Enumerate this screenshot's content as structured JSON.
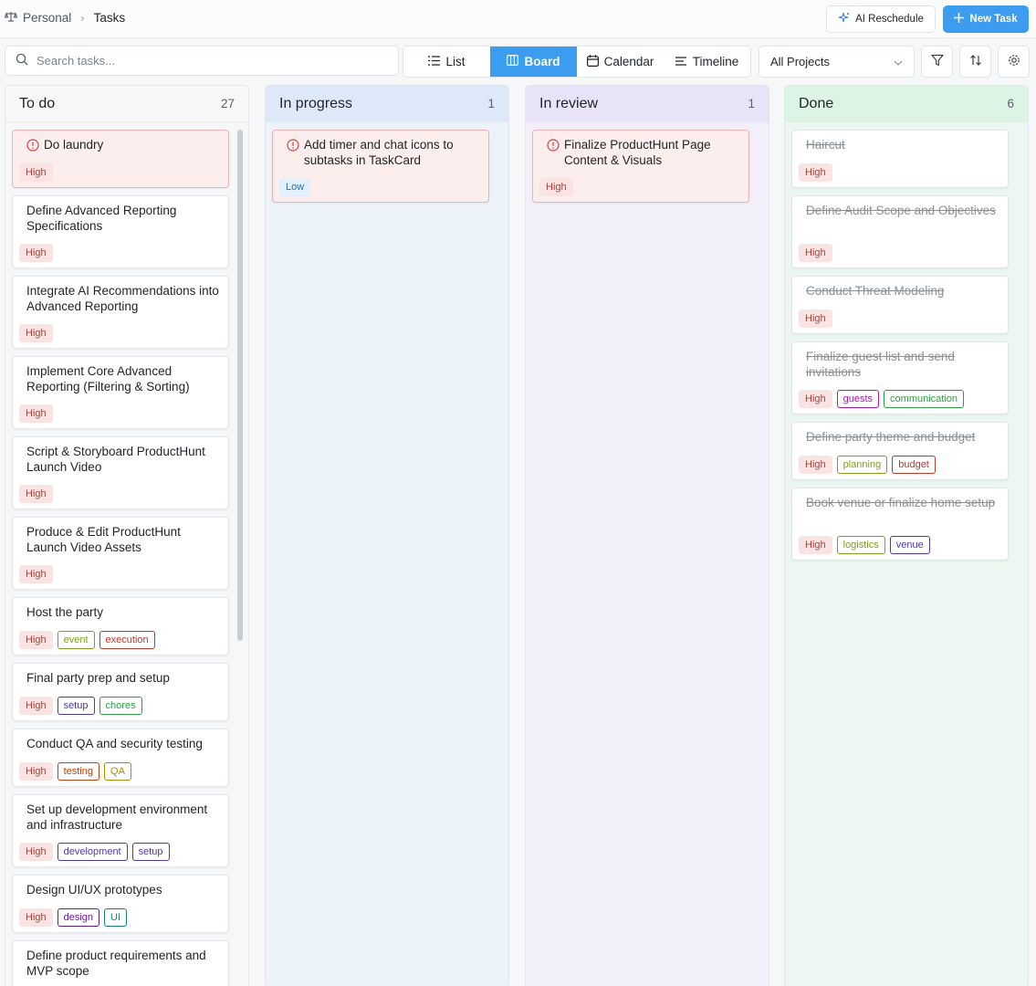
{
  "breadcrumb": {
    "parent": "Personal",
    "current": "Tasks"
  },
  "header": {
    "ai_label": "AI Reschedule",
    "new_label": "New Task"
  },
  "search": {
    "placeholder": "Search tasks..."
  },
  "views": [
    {
      "label": "List",
      "icon": "list-icon",
      "active": false
    },
    {
      "label": "Board",
      "icon": "board-icon",
      "active": true
    },
    {
      "label": "Calendar",
      "icon": "calendar-icon",
      "active": false
    },
    {
      "label": "Timeline",
      "icon": "timeline-icon",
      "active": false
    }
  ],
  "project_filter": {
    "value": "All Projects"
  },
  "tag_colors": {
    "event": "#7fa11e",
    "execution": "#c0392b",
    "setup": "#4b3ca7",
    "chores": "#2f9e44",
    "testing": "#c2410c",
    "QA": "#b58a00",
    "development": "#4b3ca7",
    "design": "#6a1b9a",
    "UI": "#14847a",
    "guests": "#a21caf",
    "communication": "#2f9e44",
    "planning": "#7fa11e",
    "budget": "#c0392b",
    "logistics": "#7fa11e",
    "venue": "#4b3ca7"
  },
  "columns": [
    {
      "title": "To do",
      "count": "27",
      "bg": "#f6f7f9",
      "head_bg": "#f6f7f9",
      "cards": [
        {
          "title": "Do laundry",
          "priority": "High",
          "tags": [],
          "urgent": true,
          "done": false
        },
        {
          "title": "Define Advanced Reporting Specifications",
          "priority": "High",
          "tags": [],
          "urgent": false,
          "done": false
        },
        {
          "title": "Integrate AI Recommendations into Advanced Reporting",
          "priority": "High",
          "tags": [],
          "urgent": false,
          "done": false
        },
        {
          "title": "Implement Core Advanced Reporting (Filtering & Sorting)",
          "priority": "High",
          "tags": [],
          "urgent": false,
          "done": false
        },
        {
          "title": "Script & Storyboard ProductHunt Launch Video",
          "priority": "High",
          "tags": [],
          "urgent": false,
          "done": false
        },
        {
          "title": "Produce & Edit ProductHunt Launch Video Assets",
          "priority": "High",
          "tags": [],
          "urgent": false,
          "done": false
        },
        {
          "title": "Host the party",
          "priority": "High",
          "tags": [
            "event",
            "execution"
          ],
          "urgent": false,
          "done": false
        },
        {
          "title": "Final party prep and setup",
          "priority": "High",
          "tags": [
            "setup",
            "chores"
          ],
          "urgent": false,
          "done": false
        },
        {
          "title": "Conduct QA and security testing",
          "priority": "High",
          "tags": [
            "testing",
            "QA"
          ],
          "urgent": false,
          "done": false
        },
        {
          "title": "Set up development environment and infrastructure",
          "priority": "High",
          "tags": [
            "development",
            "setup"
          ],
          "urgent": false,
          "done": false
        },
        {
          "title": "Design UI/UX prototypes",
          "priority": "High",
          "tags": [
            "design",
            "UI"
          ],
          "urgent": false,
          "done": false
        },
        {
          "title": "Define product requirements and MVP scope",
          "priority": "",
          "tags": [],
          "urgent": false,
          "done": false
        }
      ]
    },
    {
      "title": "In progress",
      "count": "1",
      "bg": "#edf3fb",
      "head_bg": "#dde9f8",
      "cards": [
        {
          "title": "Add timer and chat icons to subtasks in TaskCard",
          "priority": "Low",
          "tags": [],
          "urgent": true,
          "done": false
        }
      ]
    },
    {
      "title": "In review",
      "count": "1",
      "bg": "#f2effa",
      "head_bg": "#e9e3f7",
      "cards": [
        {
          "title": "Finalize ProductHunt Page Content & Visuals",
          "priority": "High",
          "tags": [],
          "urgent": true,
          "done": false
        }
      ]
    },
    {
      "title": "Done",
      "count": "6",
      "bg": "#ebf7f0",
      "head_bg": "#dcf4e4",
      "cards": [
        {
          "title": "Haircut",
          "priority": "High",
          "tags": [],
          "urgent": false,
          "done": true
        },
        {
          "title": "Define Audit Scope and Objectives",
          "priority": "High",
          "tags": [],
          "urgent": false,
          "done": true
        },
        {
          "title": "Conduct Threat Modeling",
          "priority": "High",
          "tags": [],
          "urgent": false,
          "done": true
        },
        {
          "title": "Finalize guest list and send invitations",
          "priority": "High",
          "tags": [
            "guests",
            "communication"
          ],
          "urgent": false,
          "done": true
        },
        {
          "title": "Define party theme and budget",
          "priority": "High",
          "tags": [
            "planning",
            "budget"
          ],
          "urgent": false,
          "done": true
        },
        {
          "title": "Book venue or finalize home setup",
          "priority": "High",
          "tags": [
            "logistics",
            "venue"
          ],
          "urgent": false,
          "done": true
        }
      ]
    }
  ]
}
